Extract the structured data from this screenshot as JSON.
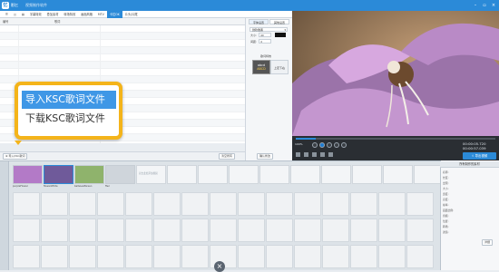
{
  "window": {
    "app_name": "影忆",
    "title": "视频制作软件",
    "logo_glyph": "忆"
  },
  "menu": {
    "items": [
      "☰",
      "◫",
      "▤",
      "字幕特效",
      "叠加素材",
      "转场特效",
      "画面风格",
      "MTV",
      "卡拉OK",
      "片头/片尾"
    ],
    "active_index": 8
  },
  "lyrics": {
    "col_no": "编号",
    "col_lyric": "歌词"
  },
  "popup": {
    "items": [
      "导入KSC歌词文件",
      "下载KSC歌词文件"
    ],
    "highlight_index": 0,
    "border_color": "#f4b41a"
  },
  "lyric_buttons": {
    "import": "导入KSC歌词",
    "clear": "清空所有",
    "confirm": "确认修改"
  },
  "props": {
    "tabs": [
      "字体设置",
      "其他设置"
    ],
    "font": "微软雅黑",
    "size_label": "大小:",
    "size_value": "40",
    "spacing_label": "间距:",
    "spacing_value": "4",
    "effect_label": "歌词特效",
    "preview_top": "abcd",
    "preview_bottom": "ABCD",
    "preview_text2": "上定下右"
  },
  "player": {
    "time_current": "00:00:05.720",
    "time_total": "00:00:57.039",
    "speed": "100%",
    "export": "导出视频"
  },
  "timeline": {
    "clips": [
      {
        "name": "purpleFlower",
        "color": "#b37ac7"
      },
      {
        "name": "flowerWhite",
        "color": "#6f5a9a"
      },
      {
        "name": "ballsLeafGreen",
        "color": "#8fb36c"
      },
      {
        "name": "flwr",
        "color": "#cfd5db"
      }
    ],
    "placeholder": "双击此处添加视频"
  },
  "right_panel": {
    "title": "所有制作的素材",
    "rows": [
      "名称:",
      "长度:",
      "出现:",
      "大小:",
      "宽度:",
      "高度:",
      "帧率:",
      "画面比例:",
      "音频:",
      "位置:",
      "转场:",
      "滤镜:"
    ],
    "button": "详细"
  },
  "colors": {
    "accent": "#2b8ad8",
    "highlight": "#3f97e6"
  }
}
